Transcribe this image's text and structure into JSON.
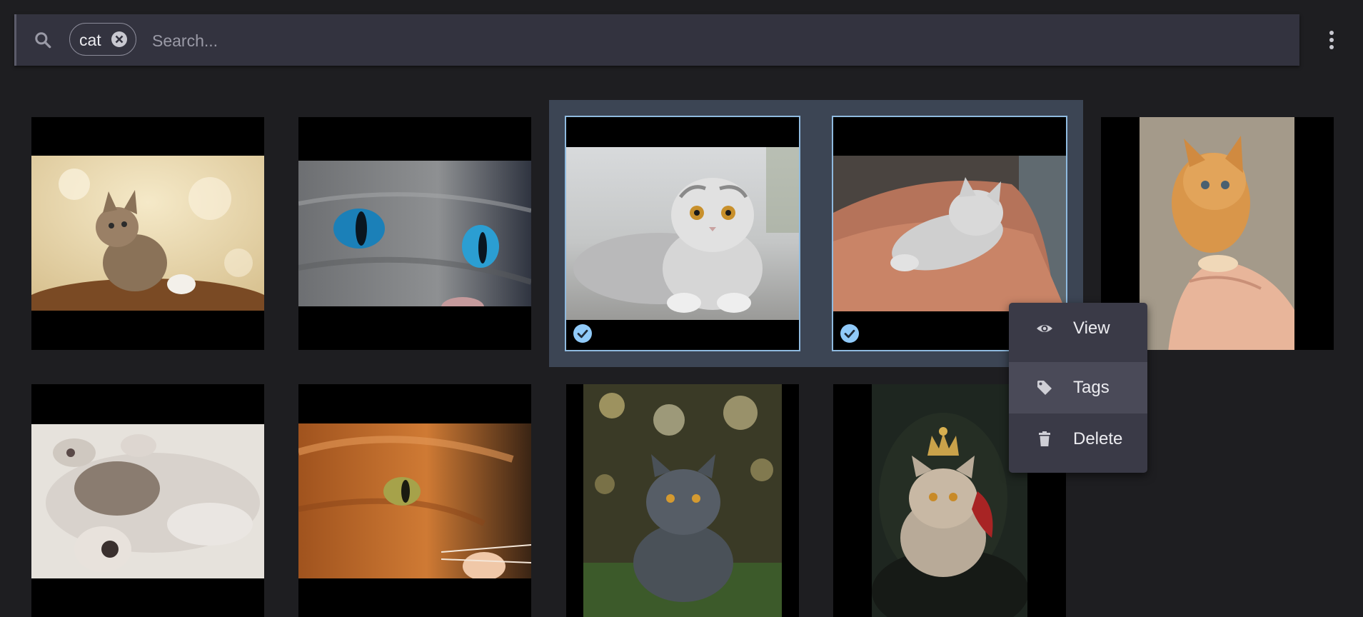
{
  "search": {
    "placeholder": "Search...",
    "value": "",
    "chips": [
      {
        "label": "cat"
      }
    ]
  },
  "icons": {
    "search": "search-icon",
    "chip_close": "close-circle-icon",
    "more": "more-vertical-icon",
    "selected": "check-circle-icon",
    "view": "eye-icon",
    "tags": "tag-icon",
    "delete": "trash-icon"
  },
  "colors": {
    "background": "#1e1e21",
    "searchbar": "#33333f",
    "selection_group": "#3c4554",
    "selected_outline": "#8fbadf",
    "check": "#90caf9",
    "menu": "#3a3a47",
    "menu_hover": "#4a4a58"
  },
  "gallery": {
    "tiles": [
      {
        "subject": "tabby kitten looking up",
        "selected": false
      },
      {
        "subject": "grey cat blue eyes close-up",
        "selected": false
      },
      {
        "subject": "silver scottish fold kitten",
        "selected": true
      },
      {
        "subject": "kitten sleeping on lap",
        "selected": true
      },
      {
        "subject": "orange kitten in hands",
        "selected": false
      },
      {
        "subject": "kittens lying on back",
        "selected": false
      },
      {
        "subject": "orange cat close-up",
        "selected": false
      },
      {
        "subject": "british shorthair in grass",
        "selected": false
      },
      {
        "subject": "cat wearing crown",
        "selected": false
      }
    ]
  },
  "context_menu": {
    "items": [
      {
        "label": "View",
        "icon": "eye-icon"
      },
      {
        "label": "Tags",
        "icon": "tag-icon",
        "hovered": true
      },
      {
        "label": "Delete",
        "icon": "trash-icon"
      }
    ]
  }
}
